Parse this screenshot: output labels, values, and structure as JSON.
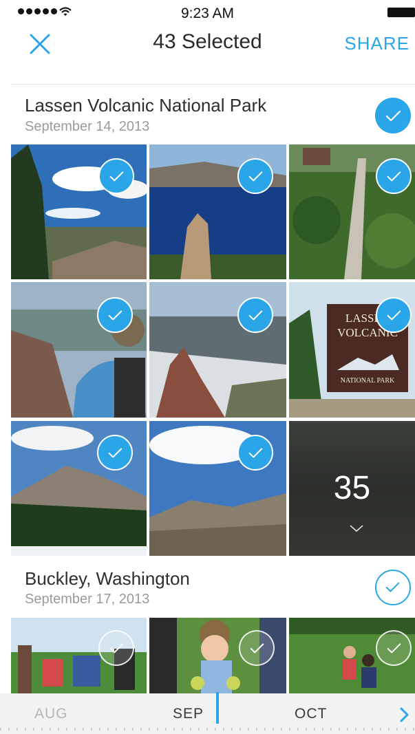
{
  "status_bar": {
    "time": "9:23 AM",
    "signal_bars": 5
  },
  "nav": {
    "title": "43 Selected",
    "share_label": "SHARE",
    "close_icon": "close-icon"
  },
  "colors": {
    "accent": "#2aa6e8",
    "text": "#2e2e2e",
    "subtext": "#9a9a9a"
  },
  "sections": [
    {
      "title": "Lassen Volcanic National Park",
      "date": "September 14, 2013",
      "selected": true
    },
    {
      "title": "Buckley, Washington",
      "date": "September 17, 2013",
      "selected": false
    }
  ],
  "more_tile": {
    "count": "35"
  },
  "photos": [
    {
      "section": 0,
      "subject": "pine trees blue sky",
      "selected": true
    },
    {
      "section": 0,
      "subject": "crater lake",
      "selected": true
    },
    {
      "section": 0,
      "subject": "forest boardwalk",
      "selected": true
    },
    {
      "section": 0,
      "subject": "hiker on rocks",
      "selected": true
    },
    {
      "section": 0,
      "subject": "mountain valley snow",
      "selected": true
    },
    {
      "section": 0,
      "subject": "lassen volcanic sign",
      "selected": true,
      "sign_text": [
        "LASSEN",
        "VOLCANIC",
        "NATIONAL PARK"
      ]
    },
    {
      "section": 0,
      "subject": "mountain with pines",
      "selected": true
    },
    {
      "section": 0,
      "subject": "clouds over peaks",
      "selected": true
    },
    {
      "section": 1,
      "subject": "picnic on grass",
      "selected": false
    },
    {
      "section": 1,
      "subject": "child with apples",
      "selected": false
    },
    {
      "section": 1,
      "subject": "kids in field",
      "selected": false
    }
  ],
  "timeline": {
    "months": [
      "AUG",
      "SEP",
      "OCT"
    ],
    "current": "SEP",
    "next_icon": "chevron-right-icon"
  }
}
